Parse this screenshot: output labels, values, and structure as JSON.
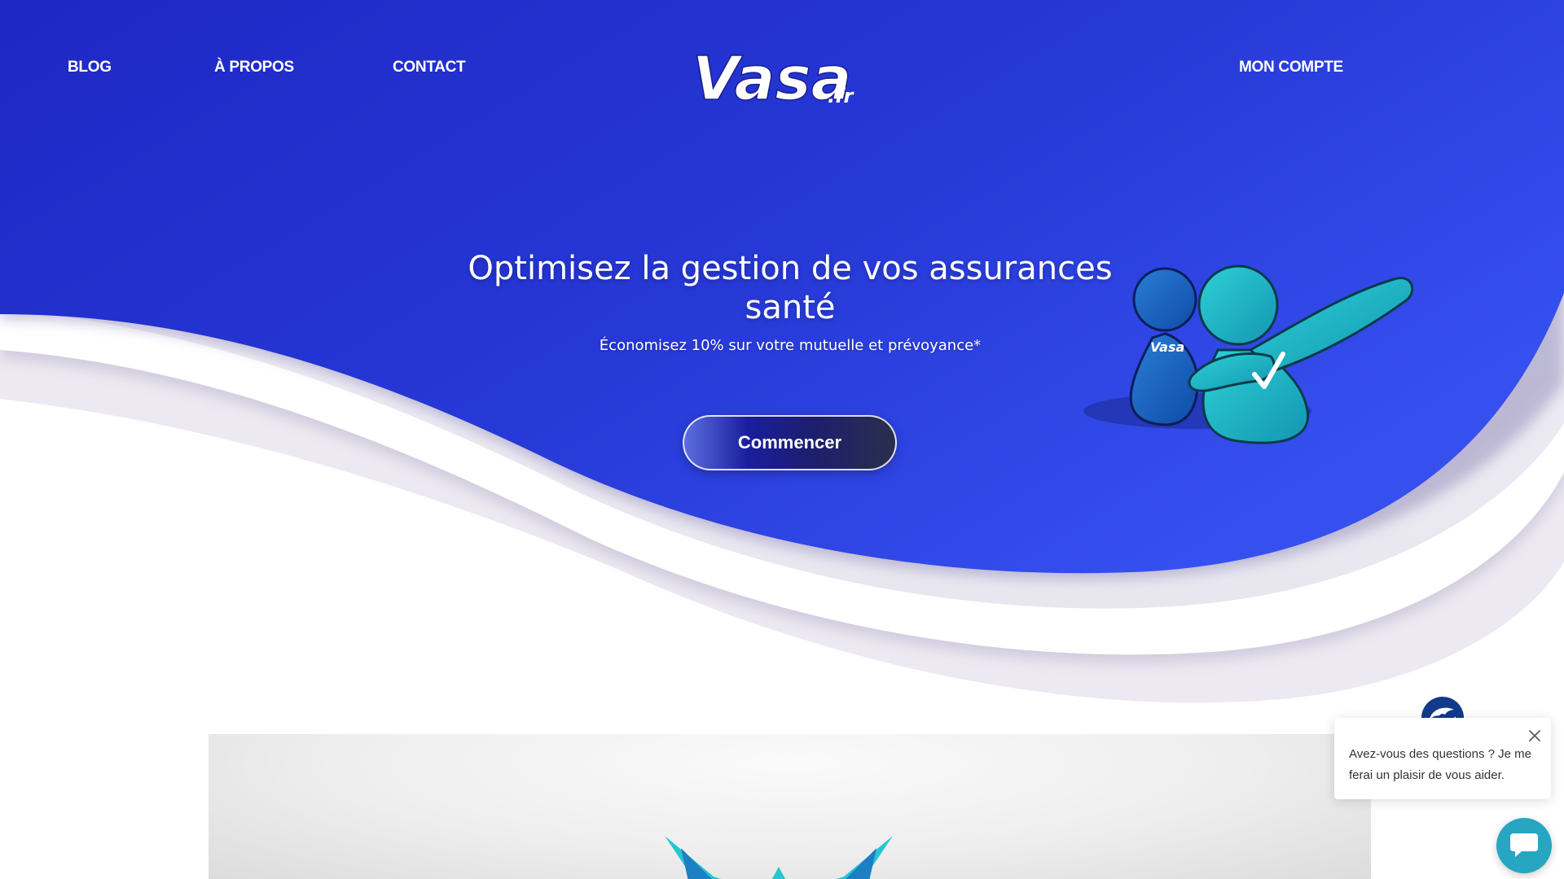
{
  "nav": {
    "blog": "BLOG",
    "about": "À PROPOS",
    "contact": "CONTACT",
    "account": "MON COMPTE"
  },
  "logo": {
    "text": "Vasa",
    "suffix": ".fr",
    "icon": "vasa-logo"
  },
  "hero": {
    "title": "Optimisez la gestion de vos assurances santé",
    "subtitle": "Économisez 10% sur votre mutuelle et prévoyance*",
    "cta_label": "Commencer",
    "mascot_icon": "mascots-illustration",
    "mascot_badge": "Vasa"
  },
  "chat": {
    "message": "Avez-vous des questions ? Je me ferai un plaisir de vous aider.",
    "close_icon": "close-icon",
    "avatar_icon": "vasa-avatar-icon",
    "launcher_icon": "chat-bubble-icon"
  },
  "colors": {
    "hero_blue": "#2a3ad8",
    "hero_blue_dark": "#1e28c8",
    "accent_teal": "#27a6c2",
    "mascot_teal": "#1bb5c9",
    "white": "#ffffff"
  }
}
